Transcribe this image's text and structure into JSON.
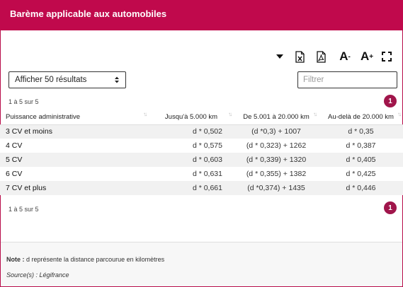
{
  "header": {
    "title": "Barème applicable aux automobiles"
  },
  "toolbar": {
    "icons": [
      "caret-down-icon",
      "excel-export-icon",
      "pdf-export-icon",
      "font-decrease-icon",
      "font-increase-icon",
      "fullscreen-icon"
    ],
    "font_decrease_label": "A",
    "font_decrease_sup": "-",
    "font_increase_label": "A",
    "font_increase_sup": "+"
  },
  "controls": {
    "page_size_selected": "Afficher 50 résultats",
    "filter_placeholder": "Filtrer"
  },
  "pagination": {
    "top_count": "1 à 5 sur 5",
    "bottom_count": "1 à 5 sur 5",
    "current_page": "1"
  },
  "table": {
    "columns": [
      "Puissance administrative",
      "Jusqu'à 5.000 km",
      "De 5.001 à 20.000 km",
      "Au-delà de 20.000 km"
    ],
    "rows": [
      [
        "3 CV et moins",
        "d * 0,502",
        "(d *0,3) + 1007",
        "d * 0,35"
      ],
      [
        "4 CV",
        "d * 0,575",
        "(d * 0,323) + 1262",
        "d * 0,387"
      ],
      [
        "5 CV",
        "d * 0,603",
        "(d * 0,339) + 1320",
        "d * 0,405"
      ],
      [
        "6 CV",
        "d * 0,631",
        "(d * 0,355) + 1382",
        "d * 0,425"
      ],
      [
        "7 CV et plus",
        "d * 0,661",
        "(d *0,374) + 1435",
        "d * 0,446"
      ]
    ]
  },
  "footer": {
    "note_label": "Note :",
    "note_text": " d représente la distance parcourue en kilomètres",
    "source_label": "Source(s) :",
    "source_text": " Légifrance"
  },
  "colors": {
    "brand": "#c0094c",
    "pager": "#a0154b",
    "row_stripe": "#f1f1f1",
    "footer_bg": "#f7f7f7"
  }
}
